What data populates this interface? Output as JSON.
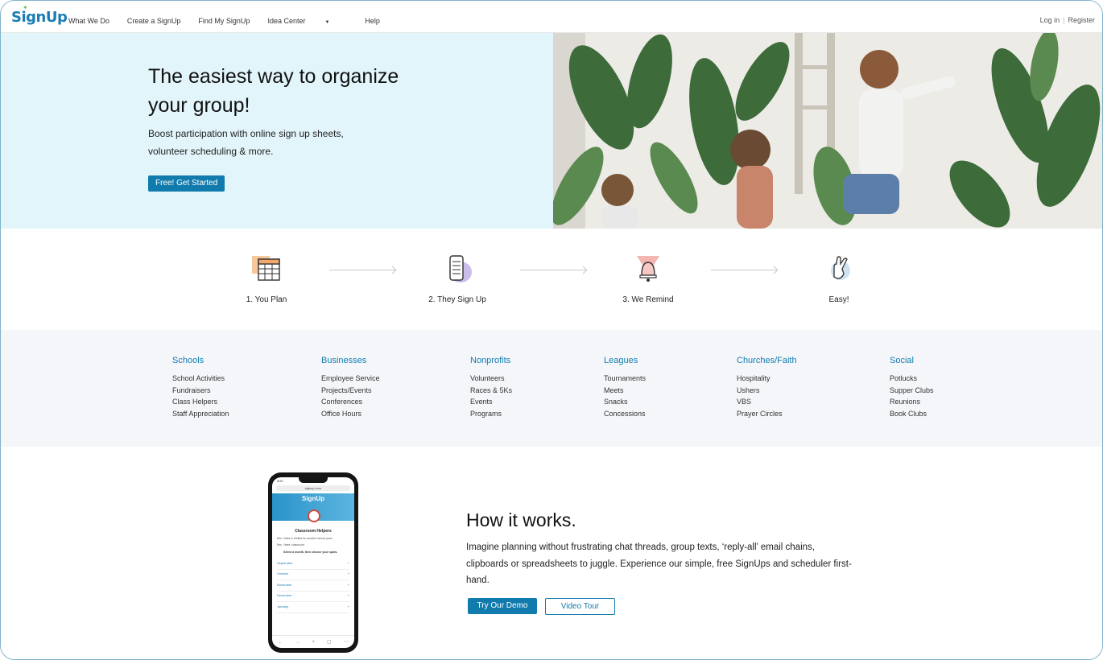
{
  "nav": {
    "logo": "SignUp",
    "links": [
      "What We Do",
      "Create a SignUp",
      "Find My SignUp",
      "Idea Center",
      "Help"
    ],
    "login": "Log in",
    "register": "Register"
  },
  "hero": {
    "title": "The easiest way to organize your group!",
    "subtitle": "Boost participation with online sign up sheets, volunteer scheduling & more.",
    "cta": "Free! Get Started"
  },
  "steps": [
    {
      "label": "1. You Plan",
      "icon": "calendar-icon"
    },
    {
      "label": "2. They Sign Up",
      "icon": "phone-checklist-icon"
    },
    {
      "label": "3. We Remind",
      "icon": "bell-icon"
    },
    {
      "label": "Easy!",
      "icon": "crossed-fingers-icon"
    }
  ],
  "categories": [
    {
      "title": "Schools",
      "items": [
        "School Activities",
        "Fundraisers",
        "Class Helpers",
        "Staff Appreciation"
      ]
    },
    {
      "title": "Businesses",
      "items": [
        "Employee Service",
        "Projects/Events",
        "Conferences",
        "Office Hours"
      ]
    },
    {
      "title": "Nonprofits",
      "items": [
        "Volunteers",
        "Races & 5Ks",
        "Events",
        "Programs"
      ]
    },
    {
      "title": "Leagues",
      "items": [
        "Tournaments",
        "Meets",
        "Snacks",
        "Concessions"
      ]
    },
    {
      "title": "Churches/Faith",
      "items": [
        "Hospitality",
        "Ushers",
        "VBS",
        "Prayer Circles"
      ]
    },
    {
      "title": "Social",
      "items": [
        "Potlucks",
        "Supper Clubs",
        "Reunions",
        "Book Clubs"
      ]
    }
  ],
  "how": {
    "title": "How it works.",
    "text": "Imagine planning without frustrating chat threads, group texts, ‘reply-all’ email chains, clipboards or spreadsheets to juggle. Experience our simple, free SignUps and scheduler first-hand.",
    "demo": "Try Our Demo",
    "video": "Video Tour"
  },
  "phone": {
    "time": "3:57",
    "url": "signup.com",
    "logo": "SignUp",
    "title": "Classroom Helpers",
    "line1": "Mrs. Yates is thrilled for another school year!",
    "line2": "Mrs. Yates' classroom",
    "line3": "Select a month, then choose your spots.",
    "months": [
      "September",
      "October",
      "November",
      "December",
      "January"
    ]
  },
  "colors": {
    "brand": "#117bad",
    "hero_bg": "#e2f5fb",
    "cats_bg": "#f4f6f9"
  }
}
